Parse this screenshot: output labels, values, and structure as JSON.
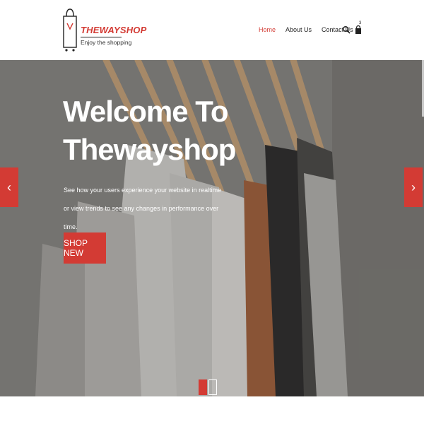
{
  "brand": {
    "name": "THEWAYSHOP",
    "tagline": "Enjoy the shopping",
    "accent": "#d33b34"
  },
  "nav": {
    "items": [
      {
        "label": "Home",
        "active": true
      },
      {
        "label": "About Us",
        "active": false
      },
      {
        "label": "Contact Us",
        "active": false
      }
    ],
    "search_icon": "search-icon",
    "cart_icon": "cart-icon",
    "cart_count": "3"
  },
  "hero": {
    "title_line1": "Welcome To",
    "title_line2": "Thewayshop",
    "text": "See how your users experience your website in realtime or view trends to see any changes in performance over time.",
    "button_label": "SHOP NEW",
    "prev_icon": "‹",
    "next_icon": "›",
    "slides_total": 2,
    "active_slide": 1
  }
}
